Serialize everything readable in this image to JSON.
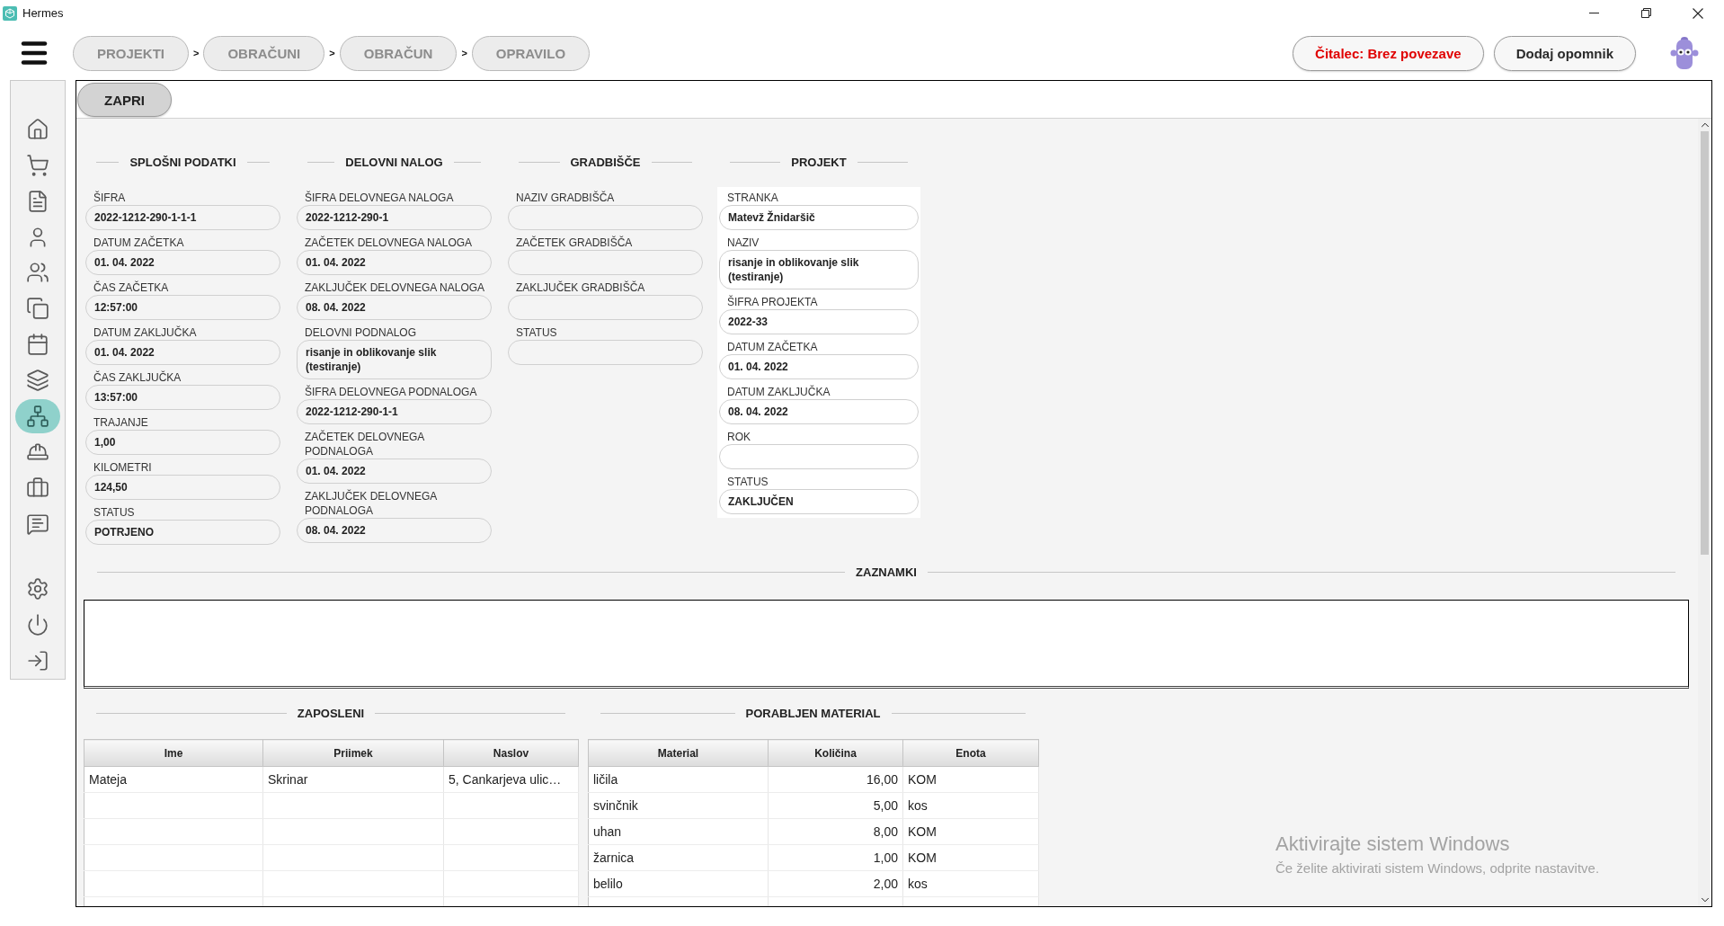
{
  "window": {
    "title": "Hermes"
  },
  "breadcrumbs": [
    {
      "label": "PROJEKTI",
      "separator": ">"
    },
    {
      "label": "OBRAČUNI",
      "separator": ">"
    },
    {
      "label": "OBRAČUN",
      "separator": ">"
    },
    {
      "label": "OPRAVILO"
    }
  ],
  "actions": [
    {
      "kind": "alert",
      "label": "Čitalec: Brez povezave"
    },
    {
      "kind": "default",
      "label": "Dodaj opomnik"
    }
  ],
  "sidebar": {
    "items": [
      {
        "selected": false
      },
      {
        "selected": false
      },
      {
        "selected": false
      },
      {
        "selected": false
      },
      {
        "selected": false
      },
      {
        "selected": false
      },
      {
        "selected": false
      },
      {
        "selected": false
      },
      {
        "selected": true
      },
      {
        "selected": false
      },
      {
        "selected": false
      },
      {
        "selected": false
      }
    ]
  },
  "toolbar": {
    "close_button": "ZAPRI"
  },
  "sections": [
    {
      "title": "SPLOŠNI PODATKI",
      "kind": "plain",
      "fields": [
        {
          "label": "ŠIFRA",
          "value": "2022-1212-290-1-1-1"
        },
        {
          "label": "DATUM ZAČETKA",
          "value": "01. 04. 2022"
        },
        {
          "label": "ČAS ZAČETKA",
          "value": "12:57:00"
        },
        {
          "label": "DATUM ZAKLJUČKA",
          "value": "01. 04. 2022"
        },
        {
          "label": "ČAS ZAKLJUČKA",
          "value": "13:57:00"
        },
        {
          "label": "TRAJANJE",
          "value": "1,00"
        },
        {
          "label": "KILOMETRI",
          "value": "124,50"
        },
        {
          "label": "STATUS",
          "value": "POTRJENO"
        }
      ]
    },
    {
      "title": "DELOVNI NALOG",
      "kind": "plain",
      "fields": [
        {
          "label": "ŠIFRA DELOVNEGA NALOGA",
          "value": "2022-1212-290-1"
        },
        {
          "label": "ZAČETEK DELOVNEGA NALOGA",
          "value": "01. 04. 2022"
        },
        {
          "label": "ZAKLJUČEK DELOVNEGA NALOGA",
          "value": "08. 04. 2022"
        },
        {
          "label": "DELOVNI PODNALOG",
          "value": "risanje in oblikovanje slik (testiranje)"
        },
        {
          "label": "ŠIFRA DELOVNEGA PODNALOGA",
          "value": "2022-1212-290-1-1"
        },
        {
          "label": "ZAČETEK DELOVNEGA PODNALOGA",
          "value": "01. 04. 2022"
        },
        {
          "label": "ZAKLJUČEK DELOVNEGA PODNALOGA",
          "value": "08. 04. 2022"
        }
      ]
    },
    {
      "title": "GRADBIŠČE",
      "kind": "plain",
      "fields": [
        {
          "label": "NAZIV GRADBIŠČA"
        },
        {
          "label": "ZAČETEK GRADBIŠČA"
        },
        {
          "label": "ZAKLJUČEK GRADBIŠČA"
        },
        {
          "label": "STATUS"
        }
      ]
    },
    {
      "title": "PROJEKT",
      "kind": "panel",
      "fields": [
        {
          "label": "STRANKA",
          "value": "Matevž Žnidaršič"
        },
        {
          "label": "NAZIV",
          "value": "risanje in oblikovanje slik (testiranje)"
        },
        {
          "label": "ŠIFRA PROJEKTA",
          "value": "2022-33"
        },
        {
          "label": "DATUM ZAČETKA",
          "value": "01. 04. 2022"
        },
        {
          "label": "DATUM ZAKLJUČKA",
          "value": "08. 04. 2022"
        },
        {
          "label": "ROK"
        },
        {
          "label": "STATUS",
          "value": "ZAKLJUČEN"
        }
      ]
    }
  ],
  "notes": {
    "title": "ZAZNAMKI"
  },
  "employees": {
    "title": "ZAPOSLENI",
    "columns": [
      "Ime",
      "Priimek",
      "Naslov"
    ],
    "rows": [
      [
        "Mateja",
        "Skrinar",
        "5, Cankarjeva ulic…"
      ]
    ]
  },
  "materials": {
    "title": "PORABLJEN MATERIAL",
    "columns": [
      "Material",
      "Količina",
      "Enota"
    ],
    "rows": [
      [
        "ličila",
        "16,00",
        "KOM"
      ],
      [
        "svinčnik",
        "5,00",
        "kos"
      ],
      [
        "uhan",
        "8,00",
        "KOM"
      ],
      [
        "žarnica",
        "1,00",
        "KOM"
      ],
      [
        "belilo",
        "2,00",
        "kos"
      ]
    ]
  },
  "activation_notice": {
    "title": "Aktivirajte sistem Windows",
    "text": "Če želite aktivirati sistem Windows, odprite nastavitve."
  }
}
